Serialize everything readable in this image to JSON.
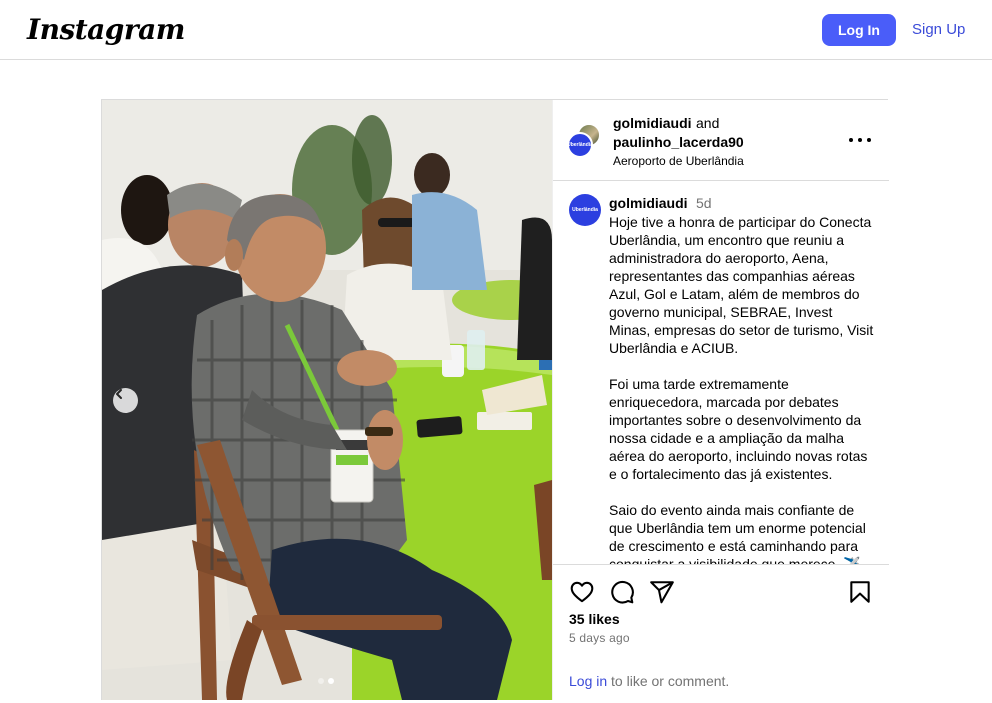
{
  "topbar": {
    "logo": "Instagram",
    "login_label": "Log In",
    "signup_label": "Sign Up"
  },
  "post": {
    "header": {
      "user1": "golmidiaudi",
      "and_word": "and",
      "user2": "paulinho_lacerda90",
      "location": "Aeroporto de Uberlândia",
      "avatar_text": "Uberlândia"
    },
    "caption": {
      "username": "golmidiaudi",
      "time": "5d",
      "paragraphs": [
        "Hoje tive a honra de participar do Conecta Uberlândia, um encontro que reuniu a administradora do aeroporto, Aena, representantes das companhias aéreas Azul, Gol e Latam, além de membros do governo municipal, SEBRAE, Invest Minas, empresas do setor de turismo, Visit Uberlândia e ACIUB.",
        "Foi uma tarde extremamente enriquecedora, marcada por debates importantes sobre o desenvolvimento da nossa cidade e a ampliação da malha aérea do aeroporto, incluindo novas rotas e o fortalecimento das já existentes.",
        "Saio do evento ainda mais confiante de que Uberlândia tem um enorme potencial de crescimento e está caminhando para conquistar a visibilidade que merece. ✈️"
      ]
    },
    "likes": "35 likes",
    "date": "5 days ago",
    "comment_cta": {
      "login_link": "Log in",
      "rest": " to like or comment."
    },
    "carousel": {
      "slide_count": 2,
      "active_index": 1
    },
    "colors": {
      "accent": "#4a5df9",
      "link": "#3b4bd8",
      "muted": "#737373",
      "table_green": "#9bd429"
    },
    "icons": [
      "heart-icon",
      "comment-icon",
      "share-icon",
      "bookmark-icon",
      "chevron-left-icon",
      "more-icon"
    ]
  }
}
